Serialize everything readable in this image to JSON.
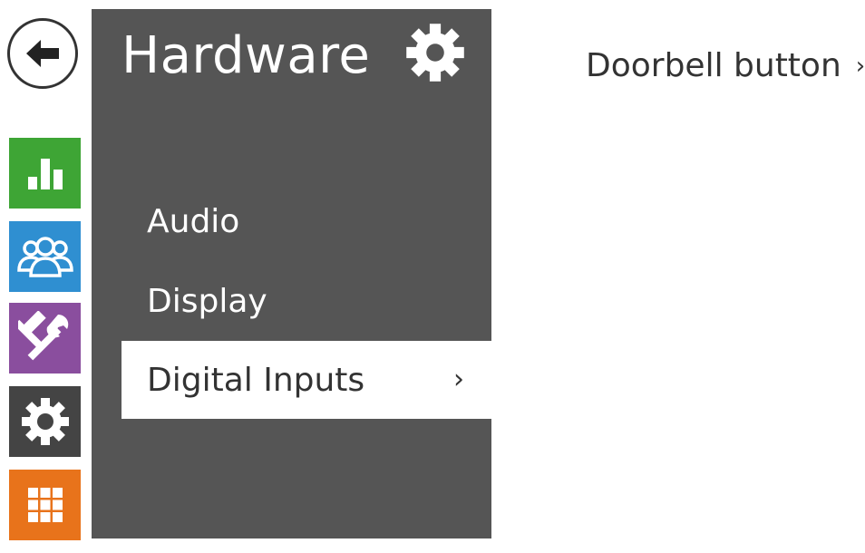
{
  "panel": {
    "title": "Hardware",
    "menu": [
      {
        "label": "Audio"
      },
      {
        "label": "Display"
      },
      {
        "label": "Digital Inputs",
        "chevron": "›"
      }
    ]
  },
  "content": {
    "link_label": "Doorbell button",
    "link_chevron": "›"
  },
  "rail": {
    "tiles": [
      {
        "icon": "bar-chart-icon",
        "color": "#3ea535"
      },
      {
        "icon": "users-icon",
        "color": "#2f8fd1"
      },
      {
        "icon": "tools-icon",
        "color": "#8a4e9e"
      },
      {
        "icon": "gear-icon",
        "color": "#444444"
      },
      {
        "icon": "grid-icon",
        "color": "#e8731b"
      }
    ]
  },
  "colors": {
    "panel_bg": "#555555",
    "active_bg": "#ffffff",
    "text_dark": "#333333"
  }
}
